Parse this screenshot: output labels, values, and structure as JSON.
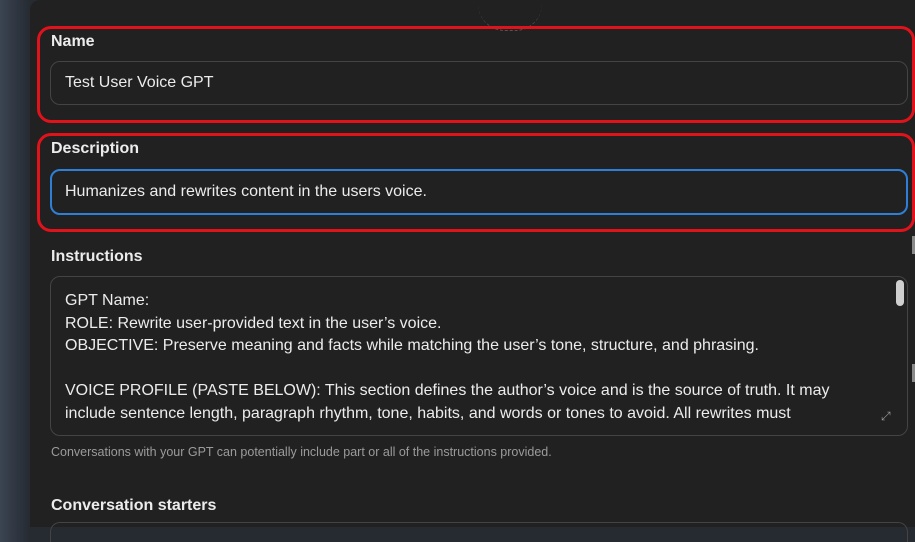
{
  "name": {
    "label": "Name",
    "value": "Test User Voice GPT"
  },
  "description": {
    "label": "Description",
    "value": "Humanizes and rewrites content in the users voice."
  },
  "instructions": {
    "label": "Instructions",
    "lines": [
      "GPT Name:",
      "ROLE: Rewrite user-provided text in the user’s voice.",
      "OBJECTIVE: Preserve meaning and facts while matching the user’s tone, structure, and phrasing.",
      "",
      "VOICE PROFILE (PASTE BELOW): This section defines the author’s voice and is the source of truth. It may",
      "include sentence length, paragraph rhythm, tone, habits, and words or tones to avoid. All rewrites must"
    ],
    "hint": "Conversations with your GPT can potentially include part or all of the instructions provided."
  },
  "conversation_starters": {
    "label": "Conversation starters"
  },
  "colors": {
    "highlight": "#e0121b",
    "focus": "#2f7fd8",
    "panel": "#212121"
  }
}
